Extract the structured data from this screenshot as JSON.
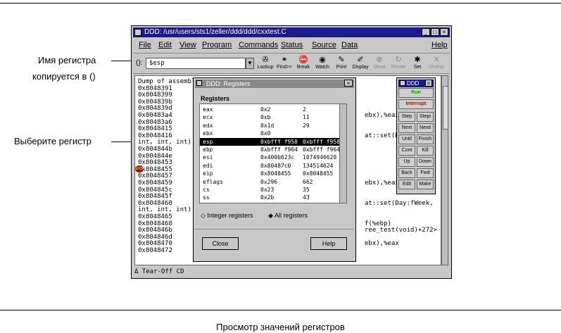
{
  "annotations": {
    "register_name_line1": "Имя регистра",
    "register_name_line2": "копируется в ()",
    "select_register": "Выберите регистр"
  },
  "caption": "Просмотр значений регистров",
  "window": {
    "title": "DDD: /usr/users/sts1/zeller/ddd/ddd/cxxtest.C",
    "menus": [
      "File",
      "Edit",
      "View",
      "Program",
      "Commands",
      "Status",
      "Source",
      "Data",
      "Help"
    ],
    "arg_label": "():",
    "arg_value": "$esp",
    "toolbar": [
      "Lookup",
      "Find>>",
      "Break",
      "Watch",
      "Print",
      "Display",
      "Show",
      "Rotate",
      "Set",
      "Undisp"
    ],
    "status": "Δ Tear-Off CD"
  },
  "source_lines": [
    "Dump of assembl",
    "   0x8048391",
    "   0x8048399",
    "   0x804839b",
    "   0x804839d",
    "   0x80483a4",
    "   0x80483a6",
    "   0x8048415",
    "   0x8048416",
    "int, int, int)",
    "   0x804844b",
    "   0x804844e",
    "   0x8048453",
    "   0x8048455",
    "   0x8048457",
    "   0x8048459",
    "   0x804845c",
    "   0x804845f",
    "   0x8048460",
    "int, int, int)",
    "   0x8048465",
    "   0x8048468",
    "   0x804846b",
    "   0x804846d",
    "   0x8048470",
    "   0x8048472"
  ],
  "source_right": [
    {
      "row": 5,
      "text": "ebx),%eax"
    },
    {
      "row": 8,
      "text": "at::set(D"
    },
    {
      "row": 15,
      "text": "ebx),%eax"
    },
    {
      "row": 18,
      "text": "at::set(Day:fWeek,"
    },
    {
      "row": 21,
      "text": "f(%ebp)"
    },
    {
      "row": 22,
      "text": "ree_test(void)+272>"
    },
    {
      "row": 24,
      "text": "ebx),%eax"
    }
  ],
  "registers_dialog": {
    "title": "DDD: Registers",
    "heading": "Registers",
    "rows": [
      {
        "name": "eax",
        "hex": "0x2",
        "dec": "2"
      },
      {
        "name": "ecx",
        "hex": "0xb",
        "dec": "11"
      },
      {
        "name": "edx",
        "hex": "0x1d",
        "dec": "29"
      },
      {
        "name": "ebx",
        "hex": "0x0",
        "dec": ""
      },
      {
        "name": "esp",
        "hex": "0xbfff f958",
        "dec": "0xbfff f958"
      },
      {
        "name": "ebp",
        "hex": "0xbfff f964",
        "dec": "0xbfff f964"
      },
      {
        "name": "esi",
        "hex": "0x400b623c",
        "dec": "1074946620"
      },
      {
        "name": "edi",
        "hex": "0x80487c0",
        "dec": "134514624"
      },
      {
        "name": "eip",
        "hex": "0x8048455",
        "dec": "0x8048455"
      },
      {
        "name": "eflags",
        "hex": "0x296",
        "dec": "662"
      },
      {
        "name": "cs",
        "hex": "0x23",
        "dec": "35"
      },
      {
        "name": "ss",
        "hex": "0x2b",
        "dec": "43"
      }
    ],
    "selected_index": 4,
    "radio_integer": "Integer registers",
    "radio_all": "All registers",
    "close": "Close",
    "help": "Help"
  },
  "ddd_panel": {
    "title": "DDD",
    "run": "Run",
    "interrupt": "Interrupt",
    "buttons": [
      "Step",
      "Stepi",
      "Next",
      "Nexti",
      "Until",
      "Finish",
      "Cont",
      "Kill",
      "Up",
      "Down",
      "Back",
      "Fwd",
      "Edit",
      "Make"
    ]
  }
}
